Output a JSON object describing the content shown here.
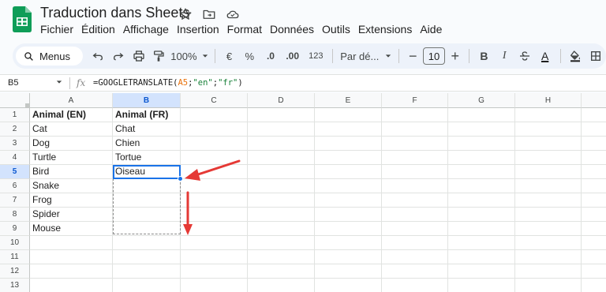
{
  "app": {
    "title": "Traduction dans Sheets",
    "menu": [
      "Fichier",
      "Édition",
      "Affichage",
      "Insertion",
      "Format",
      "Données",
      "Outils",
      "Extensions",
      "Aide"
    ]
  },
  "toolbar": {
    "search_label": "Menus",
    "zoom": "100%",
    "currency": "€",
    "percent": "%",
    "decimal_decrease": ".0",
    "decimal_increase": ".00",
    "number_format": "123",
    "font_family": "Par dé...",
    "minus": "−",
    "font_size": "10",
    "plus": "+",
    "bold": "B",
    "italic": "I",
    "text_color_letter": "A"
  },
  "formula_bar": {
    "cell_ref": "B5",
    "fx": "fx",
    "formula_prefix": "=GOOGLETRANSLATE(",
    "formula_ref": "A5",
    "formula_sep1": ";",
    "formula_src": "\"en\"",
    "formula_sep2": ";",
    "formula_dst": "\"fr\"",
    "formula_suffix": ")"
  },
  "sheet": {
    "columns": [
      "A",
      "B",
      "C",
      "D",
      "E",
      "F",
      "G",
      "H"
    ],
    "rows": [
      "1",
      "2",
      "3",
      "4",
      "5",
      "6",
      "7",
      "8",
      "9",
      "10",
      "11",
      "12",
      "13"
    ],
    "col_a": [
      "Animal (EN)",
      "Cat",
      "Dog",
      "Turtle",
      "Bird",
      "Snake",
      "Frog",
      "Spider",
      "Mouse"
    ],
    "col_b": [
      "Animal (FR)",
      "Chat",
      "Chien",
      "Tortue",
      "Oiseau"
    ],
    "selected_cell": "B5"
  },
  "colors": {
    "accent": "#1a73e8",
    "arrow": "#e53935",
    "sheets_green": "#188038"
  }
}
